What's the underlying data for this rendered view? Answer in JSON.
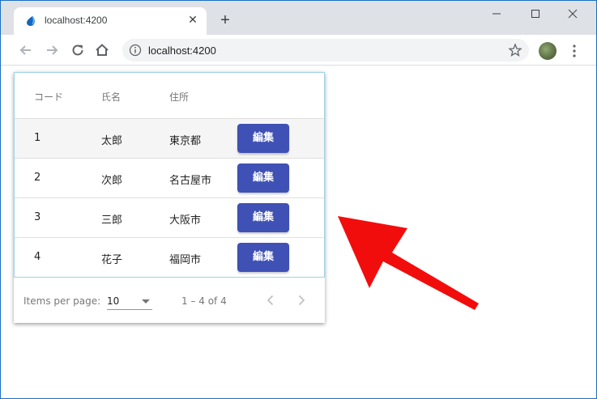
{
  "browser": {
    "tab_title": "localhost:4200",
    "url": "localhost:4200"
  },
  "table": {
    "headers": [
      "コード",
      "氏名",
      "住所"
    ],
    "rows": [
      {
        "code": "1",
        "name": "太郎",
        "address": "東京都",
        "action": "編集"
      },
      {
        "code": "2",
        "name": "次郎",
        "address": "名古屋市",
        "action": "編集"
      },
      {
        "code": "3",
        "name": "三郎",
        "address": "大阪市",
        "action": "編集"
      },
      {
        "code": "4",
        "name": "花子",
        "address": "福岡市",
        "action": "編集"
      }
    ],
    "highlighted_row": 1
  },
  "paginator": {
    "items_per_page_label": "Items per page:",
    "page_size": "10",
    "range_label": "1 – 4 of 4"
  },
  "colors": {
    "button": "#3f51b5",
    "arrow": "#f20d0d"
  }
}
